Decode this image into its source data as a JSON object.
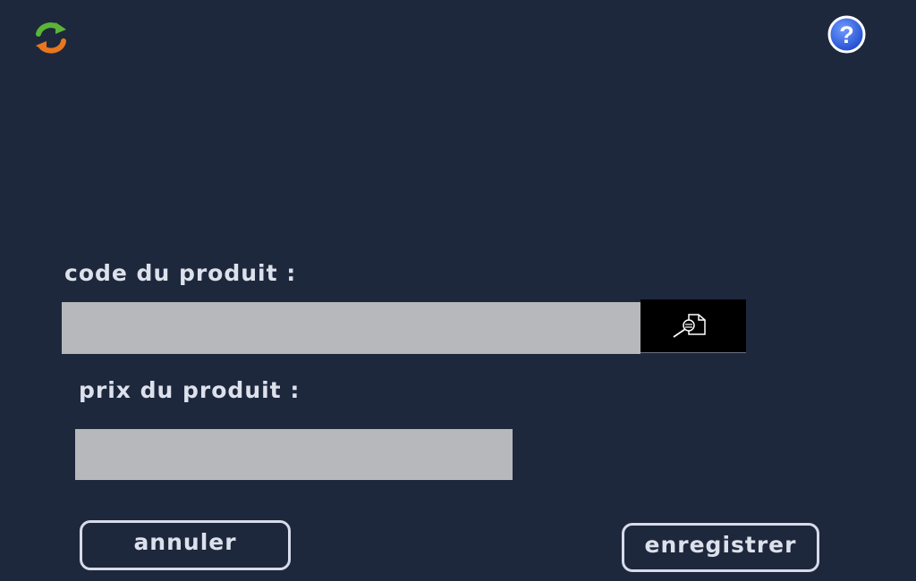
{
  "toolbar": {
    "refresh_icon": "refresh-icon",
    "help_icon": "help-icon"
  },
  "form": {
    "code_label": "code du produit :",
    "code_value": "",
    "search_icon": "search-document-icon",
    "prix_label": "prix du produit :",
    "prix_value": ""
  },
  "actions": {
    "cancel_label": "annuler",
    "save_label": "enregistrer"
  },
  "colors": {
    "background": "#1e283d",
    "field": "#b7b8bb",
    "text": "#dde1ec",
    "help_blue": "#2f5fe0"
  }
}
